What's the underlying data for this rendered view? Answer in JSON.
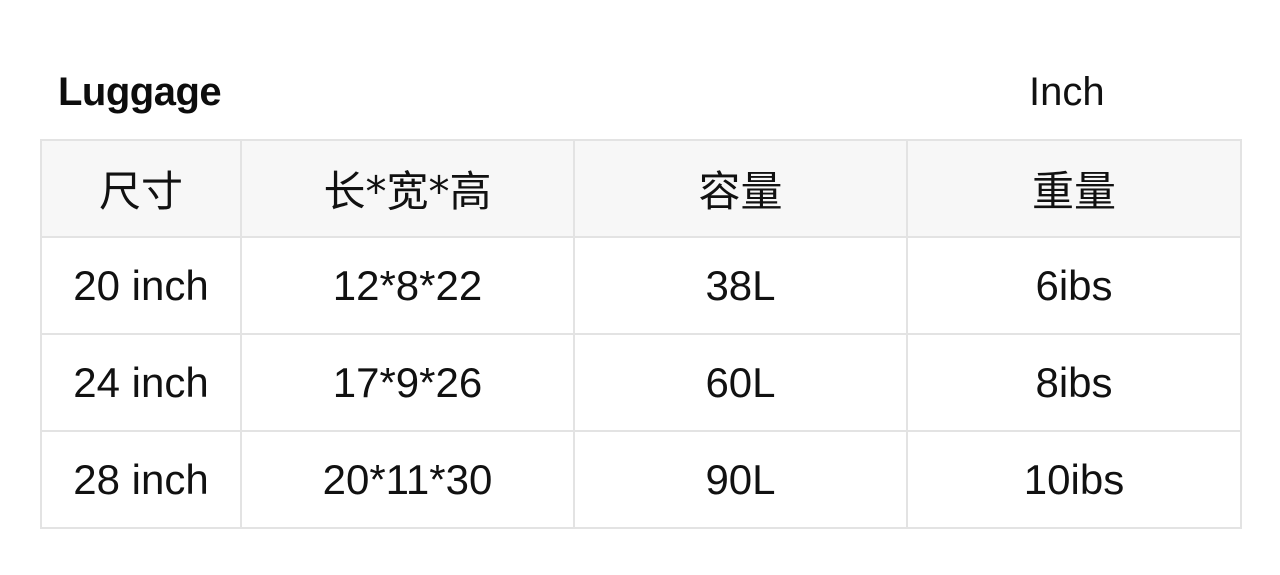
{
  "header": {
    "title": "Luggage",
    "unit": "Inch"
  },
  "table": {
    "columns": [
      "尺寸",
      "长*宽*高",
      "容量",
      "重量"
    ],
    "rows": [
      [
        "20 inch",
        "12*8*22",
        "38L",
        "6ibs"
      ],
      [
        "24 inch",
        "17*9*26",
        "60L",
        "8ibs"
      ],
      [
        "28 inch",
        "20*11*30",
        "90L",
        "10ibs"
      ]
    ]
  },
  "colors": {
    "header_background": "#f7f7f7",
    "border": "#e3e3e3",
    "text": "#111111"
  }
}
